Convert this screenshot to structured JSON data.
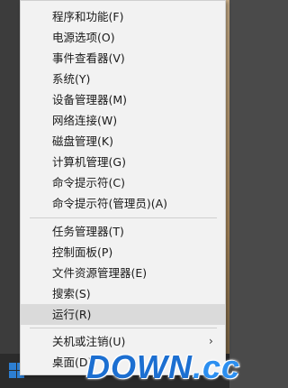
{
  "context_menu": {
    "items": [
      {
        "label": "程序和功能(F)"
      },
      {
        "label": "电源选项(O)"
      },
      {
        "label": "事件查看器(V)"
      },
      {
        "label": "系统(Y)"
      },
      {
        "label": "设备管理器(M)"
      },
      {
        "label": "网络连接(W)"
      },
      {
        "label": "磁盘管理(K)"
      },
      {
        "label": "计算机管理(G)"
      },
      {
        "label": "命令提示符(C)"
      },
      {
        "label": "命令提示符(管理员)(A)"
      },
      {
        "label": "任务管理器(T)"
      },
      {
        "label": "控制面板(P)"
      },
      {
        "label": "文件资源管理器(E)"
      },
      {
        "label": "搜索(S)"
      },
      {
        "label": "运行(R)",
        "highlighted": true
      },
      {
        "label": "关机或注销(U)",
        "has_submenu": true
      },
      {
        "label": "桌面(D)"
      }
    ],
    "submenu_arrow": "›"
  },
  "watermark": {
    "text_main": "DOWN",
    "text_dot": ".cc"
  },
  "colors": {
    "menu_bg": "#f2f2f2",
    "hover_bg": "#dadada",
    "watermark": "#1c6fd1"
  }
}
